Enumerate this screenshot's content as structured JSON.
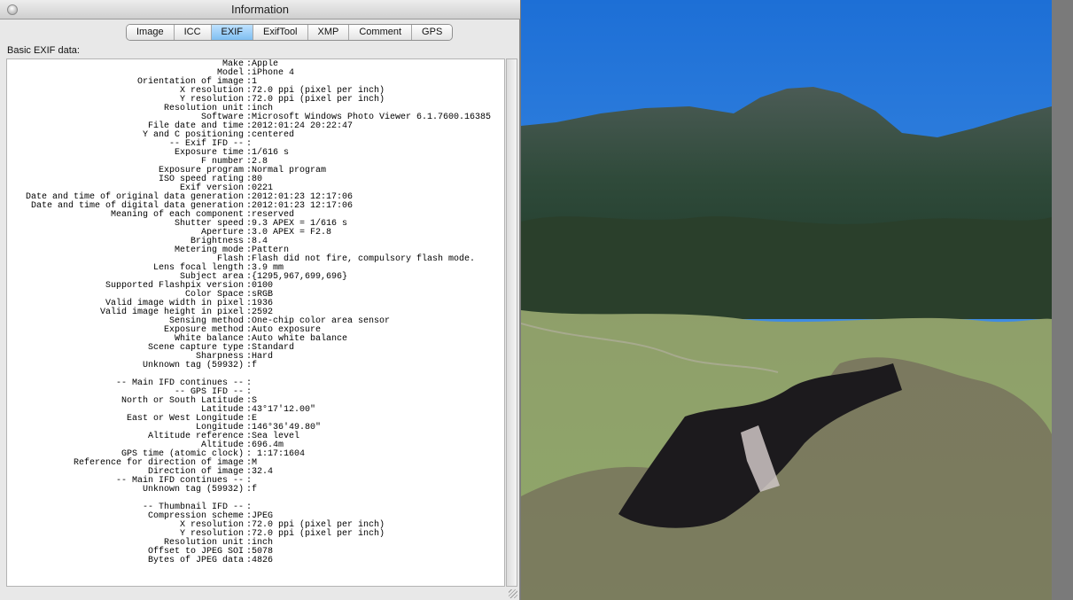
{
  "window": {
    "title": "Information"
  },
  "tabs": [
    {
      "label": "Image",
      "active": false
    },
    {
      "label": "ICC",
      "active": false
    },
    {
      "label": "EXIF",
      "active": true
    },
    {
      "label": "ExifTool",
      "active": false
    },
    {
      "label": "XMP",
      "active": false
    },
    {
      "label": "Comment",
      "active": false
    },
    {
      "label": "GPS",
      "active": false
    }
  ],
  "section_label": "Basic EXIF data:",
  "exif_rows": [
    {
      "k": "Make",
      "v": "Apple"
    },
    {
      "k": "Model",
      "v": "iPhone 4"
    },
    {
      "k": "Orientation of image",
      "v": "1"
    },
    {
      "k": "X resolution",
      "v": "72.0 ppi (pixel per inch)"
    },
    {
      "k": "Y resolution",
      "v": "72.0 ppi (pixel per inch)"
    },
    {
      "k": "Resolution unit",
      "v": "inch"
    },
    {
      "k": "Software",
      "v": "Microsoft Windows Photo Viewer 6.1.7600.16385"
    },
    {
      "k": "File date and time",
      "v": "2012:01:24 20:22:47"
    },
    {
      "k": "Y and C positioning",
      "v": "centered"
    },
    {
      "k": "-- Exif IFD --",
      "v": ""
    },
    {
      "k": "Exposure time",
      "v": "1/616 s"
    },
    {
      "k": "F number",
      "v": "2.8"
    },
    {
      "k": "Exposure program",
      "v": "Normal program"
    },
    {
      "k": "ISO speed rating",
      "v": "80"
    },
    {
      "k": "Exif version",
      "v": "0221"
    },
    {
      "k": "Date and time of original data generation",
      "v": "2012:01:23 12:17:06"
    },
    {
      "k": "Date and time of digital data generation",
      "v": "2012:01:23 12:17:06"
    },
    {
      "k": "Meaning of each component",
      "v": "reserved"
    },
    {
      "k": "Shutter speed",
      "v": "9.3 APEX = 1/616 s"
    },
    {
      "k": "Aperture",
      "v": "3.0 APEX = F2.8"
    },
    {
      "k": "Brightness",
      "v": "8.4"
    },
    {
      "k": "Metering mode",
      "v": "Pattern"
    },
    {
      "k": "Flash",
      "v": "Flash did not fire, compulsory flash mode."
    },
    {
      "k": "Lens focal length",
      "v": "3.9 mm"
    },
    {
      "k": "Subject area",
      "v": "{1295,967,699,696}"
    },
    {
      "k": "Supported Flashpix version",
      "v": "0100"
    },
    {
      "k": "Color Space",
      "v": "sRGB"
    },
    {
      "k": "Valid image width in pixel",
      "v": "1936"
    },
    {
      "k": "Valid image height in pixel",
      "v": "2592"
    },
    {
      "k": "Sensing method",
      "v": "One-chip color area sensor"
    },
    {
      "k": "Exposure method",
      "v": "Auto exposure"
    },
    {
      "k": "White balance",
      "v": "Auto white balance"
    },
    {
      "k": "Scene capture type",
      "v": "Standard"
    },
    {
      "k": "Sharpness",
      "v": "Hard"
    },
    {
      "k": "Unknown tag (59932)",
      "v": "f"
    },
    {
      "k": "",
      "v": ""
    },
    {
      "k": "-- Main IFD continues --",
      "v": ""
    },
    {
      "k": "-- GPS IFD --",
      "v": ""
    },
    {
      "k": "North or South Latitude",
      "v": "S"
    },
    {
      "k": "Latitude",
      "v": "43°17'12.00\""
    },
    {
      "k": "East or West Longitude",
      "v": "E"
    },
    {
      "k": "Longitude",
      "v": "146°36'49.80\""
    },
    {
      "k": "Altitude reference",
      "v": "Sea level"
    },
    {
      "k": "Altitude",
      "v": "696.4m"
    },
    {
      "k": "GPS time (atomic clock)",
      "v": " 1:17:1604"
    },
    {
      "k": "Reference for direction of image",
      "v": "M"
    },
    {
      "k": "Direction of image",
      "v": "32.4"
    },
    {
      "k": "-- Main IFD continues --",
      "v": ""
    },
    {
      "k": "Unknown tag (59932)",
      "v": "f"
    },
    {
      "k": "",
      "v": ""
    },
    {
      "k": "-- Thumbnail IFD --",
      "v": ""
    },
    {
      "k": "Compression scheme",
      "v": "JPEG"
    },
    {
      "k": "X resolution",
      "v": "72.0 ppi (pixel per inch)"
    },
    {
      "k": "Y resolution",
      "v": "72.0 ppi (pixel per inch)"
    },
    {
      "k": "Resolution unit",
      "v": "inch"
    },
    {
      "k": "Offset to JPEG SOI",
      "v": "5078"
    },
    {
      "k": "Bytes of JPEG data",
      "v": "4826"
    }
  ],
  "colors": {
    "sky_top": "#1d6fd6",
    "sky_bottom": "#5aa4ee",
    "mountain": "#2f4a3a",
    "grass": "#8fa869",
    "rock": "#6b5a55",
    "water": "#1c1a1d",
    "active_tab": "#7fbef1"
  }
}
